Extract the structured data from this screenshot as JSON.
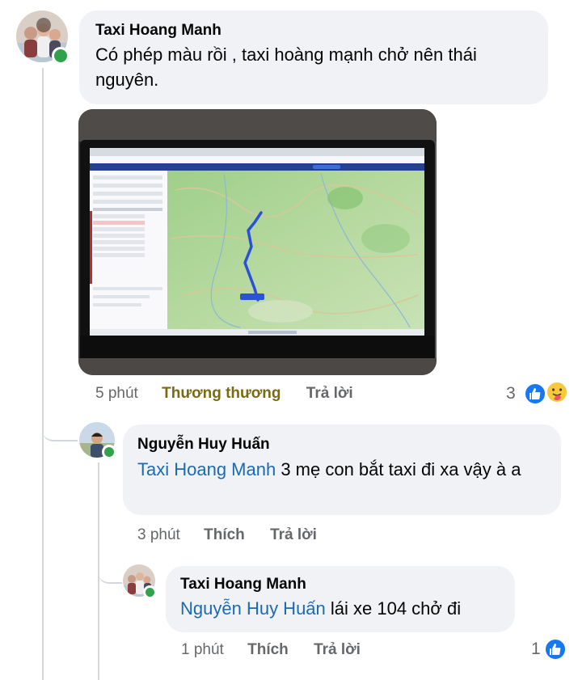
{
  "comment1": {
    "author": "Taxi Hoang Manh",
    "text": "Có phép màu rồi , taxi hoàng mạnh chở nên thái nguyên.",
    "time": "5 phút",
    "reaction_label": "Thương thương",
    "reply_label": "Trả lời",
    "reaction_count": "3",
    "reaction_label_color": "#7a6a12"
  },
  "comment2": {
    "author": "Nguyễn Huy Huấn",
    "mention": "Taxi Hoang Manh",
    "text": " 3 mẹ con bắt taxi đi xa vậy à a",
    "time": "3 phút",
    "like_label": "Thích",
    "reply_label": "Trả lời"
  },
  "comment3": {
    "author": "Taxi Hoang Manh",
    "mention": "Nguyễn Huy Huấn",
    "text": " lái xe 104 chở đi",
    "time": "1 phút",
    "like_label": "Thích",
    "reply_label": "Trả lời",
    "reaction_count": "1"
  },
  "icons": [
    "online-status-icon",
    "like-reaction-icon",
    "care-reaction-icon"
  ],
  "colors": {
    "mention": "#1a6ab6",
    "like": "#1877f2",
    "online": "#31a24c",
    "bubble": "#f0f2f5"
  }
}
